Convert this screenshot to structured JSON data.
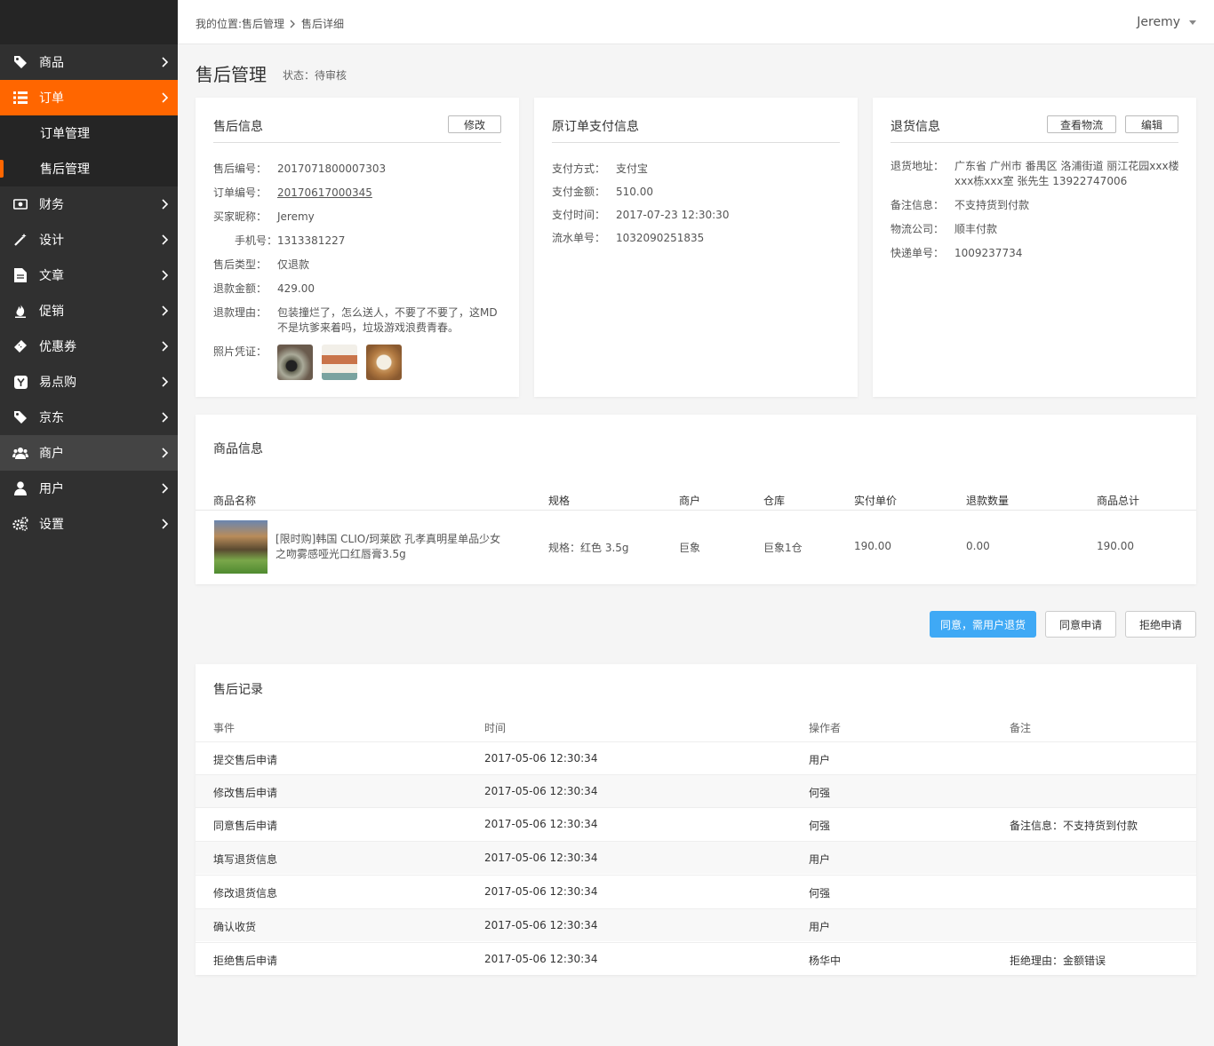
{
  "sidebar": {
    "items": [
      {
        "label": "商品",
        "icon": "tag-icon"
      },
      {
        "label": "订单",
        "icon": "list-icon"
      },
      {
        "label": "财务",
        "icon": "money-icon"
      },
      {
        "label": "设计",
        "icon": "magic-wand-icon"
      },
      {
        "label": "文章",
        "icon": "document-icon"
      },
      {
        "label": "促销",
        "icon": "fire-icon"
      },
      {
        "label": "优惠券",
        "icon": "ticket-icon"
      },
      {
        "label": "易点购",
        "icon": "y-logo-icon"
      },
      {
        "label": "京东",
        "icon": "tag-icon"
      },
      {
        "label": "商户",
        "icon": "users-icon"
      },
      {
        "label": "用户",
        "icon": "user-icon"
      },
      {
        "label": "设置",
        "icon": "gears-icon"
      }
    ],
    "subitems": [
      "订单管理",
      "售后管理"
    ]
  },
  "header": {
    "crumb_prefix": "我的位置:售后管理",
    "crumb_current": "售后详细",
    "user": "Jeremy"
  },
  "page": {
    "title": "售后管理",
    "status": "状态：待审核"
  },
  "aftersale": {
    "title": "售后信息",
    "edit_btn": "修改",
    "rows": [
      {
        "label": "售后编号：",
        "value": "2017071800007303"
      },
      {
        "label": "订单编号：",
        "value": "20170617000345"
      },
      {
        "label": "买家昵称：",
        "value": "Jeremy"
      },
      {
        "label": "手机号：",
        "value": "1313381227"
      },
      {
        "label": "售后类型：",
        "value": "仅退款"
      },
      {
        "label": "退款金额：",
        "value": "429.00"
      },
      {
        "label": "退款理由：",
        "value": "包装撞烂了，怎么送人，不要了不要了，这MD不是坑爹来着吗，垃圾游戏浪费青春。"
      },
      {
        "label": "照片凭证：",
        "value": ""
      }
    ]
  },
  "payment": {
    "title": "原订单支付信息",
    "rows": [
      {
        "label": "支付方式：",
        "value": "支付宝"
      },
      {
        "label": "支付金额：",
        "value": "510.00"
      },
      {
        "label": "支付时间：",
        "value": "2017-07-23 12:30:30"
      },
      {
        "label": "流水单号：",
        "value": "1032090251835"
      }
    ]
  },
  "returns": {
    "title": "退货信息",
    "btn_logistics": "查看物流",
    "btn_edit": "编辑",
    "rows": [
      {
        "label": "退货地址：",
        "value": "广东省 广州市 番禺区 洛浦街道 丽江花园xxx楼xxx栋xxx室  张先生  13922747006"
      },
      {
        "label": "备注信息：",
        "value": "不支持货到付款"
      },
      {
        "label": "物流公司：",
        "value": "顺丰付款"
      },
      {
        "label": "快递单号：",
        "value": "1009237734"
      }
    ]
  },
  "goods": {
    "title": "商品信息",
    "headers": [
      "商品名称",
      "规格",
      "商户",
      "仓库",
      "实付单价",
      "退款数量",
      "商品总计"
    ],
    "item": {
      "name": "[限时购]韩国 CLIO/珂莱欧 孔孝真明星单品少女之吻雾感哑光口红唇膏3.5g",
      "spec": "规格：红色 3.5g",
      "merchant": "巨象",
      "warehouse": "巨象1仓",
      "price": "190.00",
      "qty": "0.00",
      "total": "190.00"
    }
  },
  "actions": {
    "agree_return": "同意，需用户退货",
    "agree": "同意申请",
    "reject": "拒绝申请"
  },
  "log": {
    "title": "售后记录",
    "headers": [
      "事件",
      "时间",
      "操作者",
      "备注"
    ],
    "rows": [
      {
        "event": "提交售后申请",
        "time": "2017-05-06 12:30:34",
        "op": "用户",
        "note": ""
      },
      {
        "event": "修改售后申请",
        "time": "2017-05-06 12:30:34",
        "op": "何强",
        "note": ""
      },
      {
        "event": "同意售后申请",
        "time": "2017-05-06 12:30:34",
        "op": "何强",
        "note": "备注信息：不支持货到付款"
      },
      {
        "event": "填写退货信息",
        "time": "2017-05-06 12:30:34",
        "op": "用户",
        "note": ""
      },
      {
        "event": "修改退货信息",
        "time": "2017-05-06 12:30:34",
        "op": "何强",
        "note": ""
      },
      {
        "event": "确认收货",
        "time": "2017-05-06 12:30:34",
        "op": "用户",
        "note": ""
      },
      {
        "event": "拒绝售后申请",
        "time": "2017-05-06 12:30:34",
        "op": "杨华中",
        "note": "拒绝理由：金额错误"
      }
    ]
  }
}
